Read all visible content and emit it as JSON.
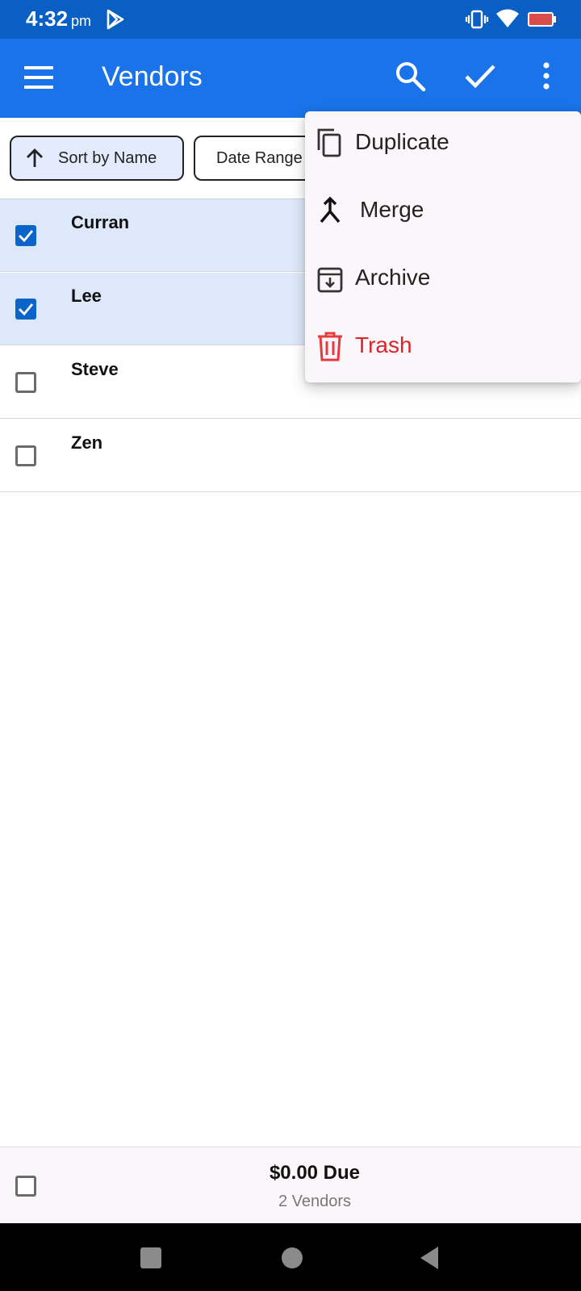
{
  "status_bar": {
    "time": "4:32",
    "ampm": "pm"
  },
  "app_bar": {
    "title": "Vendors"
  },
  "filters": {
    "sort_label": "Sort by Name",
    "date_label": "Date Range"
  },
  "vendors": [
    {
      "name": "Curran",
      "checked": true
    },
    {
      "name": "Lee",
      "checked": true
    },
    {
      "name": "Steve",
      "checked": false
    },
    {
      "name": "Zen",
      "checked": false
    }
  ],
  "overflow_menu": {
    "items": [
      {
        "label": "Duplicate",
        "icon": "copy-icon"
      },
      {
        "label": "Merge",
        "icon": "merge-icon"
      },
      {
        "label": "Archive",
        "icon": "archive-icon"
      },
      {
        "label": "Trash",
        "icon": "trash-icon",
        "color": "#d9262c"
      }
    ]
  },
  "footer": {
    "amount": "$0.00 Due",
    "count": "2 Vendors"
  },
  "colors": {
    "status_bar": "#0a5fc4",
    "app_bar": "#1a73e8",
    "selected_row": "#dde9fb",
    "checkbox": "#0b64c8",
    "danger": "#d9262c"
  }
}
